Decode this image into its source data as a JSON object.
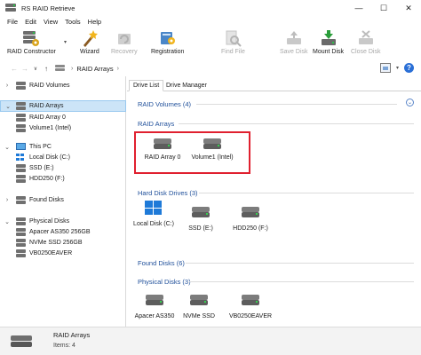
{
  "window": {
    "title": "RS RAID Retrieve",
    "controls": {
      "minimize": "—",
      "maximize": "☐",
      "close": "✕"
    }
  },
  "menu": {
    "items": [
      "File",
      "Edit",
      "View",
      "Tools",
      "Help"
    ]
  },
  "toolbar": {
    "raid_constructor": "RAID Constructor",
    "wizard": "Wizard",
    "recovery": "Recovery",
    "registration": "Registration",
    "find_file": "Find File",
    "save_disk": "Save Disk",
    "mount_disk": "Mount Disk",
    "close_disk": "Close Disk"
  },
  "navbar": {
    "back": "←",
    "forward": "→",
    "dropdown": "∨",
    "up": "↑",
    "breadcrumb": "RAID Arrays",
    "breadcrumb_caret": "›"
  },
  "sidebar": {
    "raid_volumes": "RAID Volumes",
    "raid_arrays": "RAID Arrays",
    "raid_array_0": "RAID Array  0",
    "volume1": "Volume1 (Intel)",
    "this_pc": "This PC",
    "local_disk_c": "Local Disk (C:)",
    "ssd_e": "SSD (E:)",
    "hdd250_f": "HDD250 (F:)",
    "found_disks": "Found Disks",
    "physical_disks": "Physical Disks",
    "apacer": "Apacer AS350 256GB",
    "nvme": "NVMe SSD 256GB",
    "vb0250": "VB0250EAVER"
  },
  "tabs": {
    "drive_list": "Drive List",
    "drive_manager": "Drive Manager"
  },
  "sections": {
    "raid_volumes": "RAID Volumes (4)",
    "raid_arrays": "RAID Arrays",
    "hard_disk_drives": "Hard Disk Drives (3)",
    "found_disks": "Found Disks (6)",
    "physical_disks": "Physical Disks (3)"
  },
  "items": {
    "raid_array_0": "RAID Array  0",
    "volume1": "Volume1 (Intel)",
    "local_disk_c": "Local Disk (C:)",
    "ssd_e": "SSD (E:)",
    "hdd250_f": "HDD250 (F:)",
    "apacer": "Apacer AS350",
    "nvme": "NVMe SSD",
    "vb0250": "VB0250EAVER"
  },
  "status": {
    "title": "RAID Arrays",
    "items_count": "Items: 4"
  },
  "colors": {
    "selection": "#cce4f7",
    "section_heading": "#1f4f9a",
    "highlight_box": "#e0202f"
  }
}
